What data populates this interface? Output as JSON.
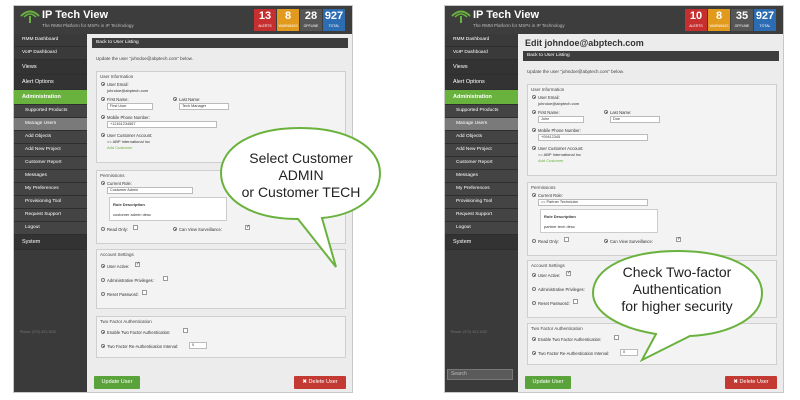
{
  "header": {
    "brand": "IP Tech View",
    "tagline": "The RMM Platform for MSPs in IP Technology"
  },
  "left": {
    "counters": [
      {
        "num": "13",
        "label": "ALERTS"
      },
      {
        "num": "8",
        "label": "WARNINGS"
      },
      {
        "num": "28",
        "label": "OFFLINE"
      },
      {
        "num": "927",
        "label": "TOTAL"
      }
    ],
    "nav": {
      "rmm": "RMM Dashboard",
      "voip": "VoIP Dashboard",
      "views": "Views",
      "alert": "Alert Options",
      "admin": "Administration",
      "supported": "Supported Products",
      "manage": "Manage Users",
      "add_objects": "Add Objects",
      "add_project": "Add New Project",
      "customer_report": "Customer Report",
      "messages": "Messages",
      "prefs": "My Preferences",
      "prov": "Provisioning Tool",
      "support": "Request Support",
      "logout": "Logout",
      "system": "System",
      "footer": "Phone: (972) 401-1030"
    },
    "back": "Back to User Listing",
    "intro": "Update the user \"johndoe@abptech.com\" below.",
    "user_info": {
      "title": "User Information",
      "email_label": "User Email:",
      "email_value": "johndoe@abptech.com",
      "first_label": "First Name:",
      "first_value": "First User",
      "last_label": "Last Name:",
      "last_value": "Tech Manager",
      "phone_label": "Mobile Phone Number:",
      "phone_value": "+12161234567",
      "account_label": "User Customer Account:",
      "account_value": "== ABP International Inc",
      "add_customer": "Add Customer"
    },
    "perms": {
      "title": "Permissions",
      "role_label": "Current Role:",
      "role_value": "Customer Admin",
      "role_head": "Role Description",
      "role_desc": "customer admin desc",
      "read_only": "Read Only:",
      "can_view": "Can View Surveillance:"
    },
    "account": {
      "title": "Account Settings",
      "active": "User Active:",
      "admin_priv": "Administrative Privileges:",
      "reset": "Reset Password:"
    },
    "twofa": {
      "title": "Two Factor Authentication",
      "enable": "Enable Two Factor Authentication:",
      "interval": "Two Factor Re-Authentication Interval:",
      "interval_value": "0"
    },
    "update_btn": "Update User",
    "delete_btn": "✖ Delete User",
    "callout_line1": "Select Customer ADMIN",
    "callout_line2": "or Customer TECH"
  },
  "right": {
    "counters": [
      {
        "num": "10",
        "label": "ALERTS"
      },
      {
        "num": "8",
        "label": "WARNINGS"
      },
      {
        "num": "35",
        "label": "OFFLINE"
      },
      {
        "num": "927",
        "label": "TOTAL"
      }
    ],
    "nav": {
      "rmm": "RMM Dashboard",
      "voip": "VoIP Dashboard",
      "views": "Views",
      "alert": "Alert Options",
      "admin": "Administration",
      "supported": "Supported Products",
      "manage": "Manage Users",
      "add_objects": "Add Objects",
      "add_project": "Add New Project",
      "customer_report": "Customer Report",
      "messages": "Messages",
      "prefs": "My Preferences",
      "prov": "Provisioning Tool",
      "support": "Request Support",
      "logout": "Logout",
      "system": "System",
      "footer": "Phone: (972) 401-1030",
      "search": "Search"
    },
    "page_title": "Edit johndoe@abptech.com",
    "back": "Back to User Listing",
    "intro": "Update the user \"johndoe@abptech.com\" below.",
    "user_info": {
      "title": "User Information",
      "email_label": "User Email:",
      "email_value": "johndoe@abptech.com",
      "first_label": "First Name:",
      "first_value": "John",
      "last_label": "Last Name:",
      "last_value": "Doe",
      "phone_label": "Mobile Phone Number:",
      "phone_value": "+09412345",
      "account_label": "User Customer Account:",
      "account_value": "== ABP International Inc",
      "add_customer": "Add Customer"
    },
    "perms": {
      "title": "Permissions",
      "role_label": "Current Role:",
      "role_value": "== Partner Technician",
      "role_head": "Role Description",
      "role_desc": "partner tech desc",
      "read_only": "Read Only:",
      "can_view": "Can View Surveillance:"
    },
    "account": {
      "title": "Account Settings",
      "active": "User Active:",
      "admin_priv": "Administrative Privileges:",
      "reset": "Reset Password:"
    },
    "twofa": {
      "title": "Two Factor Authentication",
      "enable": "Enable Two Factor Authentication:",
      "interval": "Two Factor Re-Authentication Interval:",
      "interval_value": "0"
    },
    "update_btn": "Update User",
    "delete_btn": "✖ Delete User",
    "callout_line1": "Check Two-factor",
    "callout_line2": "Authentication",
    "callout_line3": "for higher security"
  },
  "colors": {
    "accent_green": "#6ab23e",
    "alerts_red": "#c62f2f",
    "warnings_orange": "#e29a1e",
    "total_blue": "#2b6cb3",
    "delete_red": "#c23a32"
  }
}
